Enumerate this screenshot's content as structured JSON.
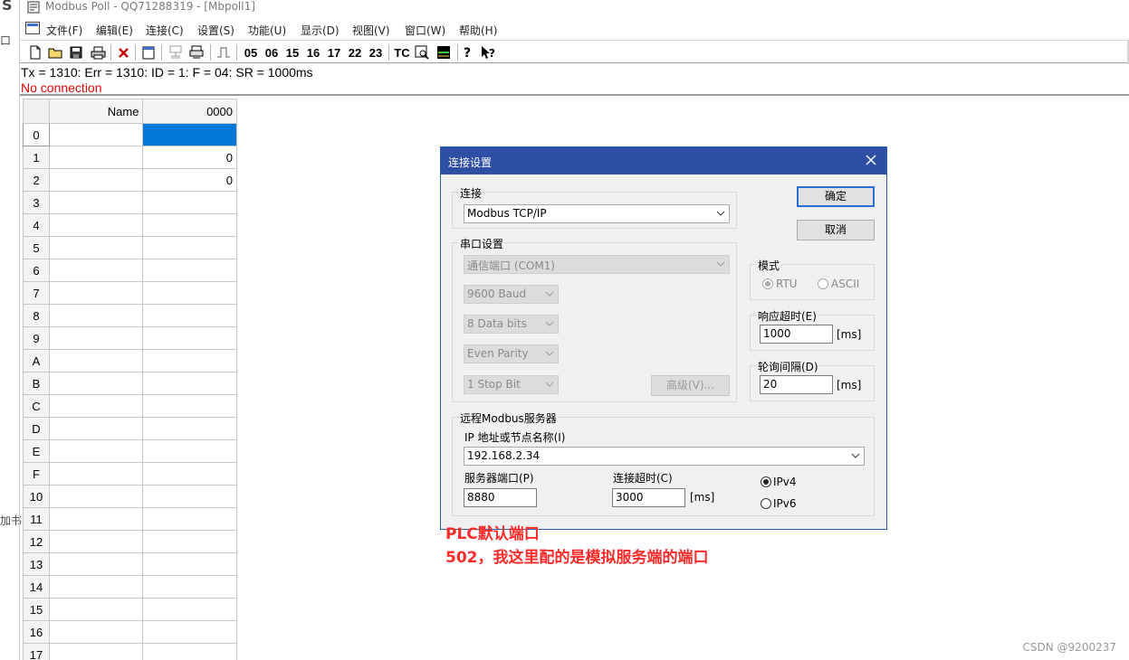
{
  "window": {
    "title": "Modbus Poll - QQ71288319 - [Mbpoll1]"
  },
  "background_fragments": [
    "S",
    "口",
    "加书"
  ],
  "menu": {
    "items": [
      "文件(F)",
      "编辑(E)",
      "连接(C)",
      "设置(S)",
      "功能(U)",
      "显示(D)",
      "视图(V)",
      "窗口(W)",
      "帮助(H)"
    ]
  },
  "toolbar": {
    "function_codes": [
      "05",
      "06",
      "15",
      "16",
      "17",
      "22",
      "23"
    ],
    "tc_label": "TC"
  },
  "status": {
    "line1": "Tx = 1310: Err = 1310: ID = 1: F = 04: SR = 1000ms",
    "line2": "No connection"
  },
  "grid": {
    "col_name": "Name",
    "col_value": "0000",
    "rows": [
      {
        "idx": "0",
        "name": "",
        "value": ""
      },
      {
        "idx": "1",
        "name": "",
        "value": "0"
      },
      {
        "idx": "2",
        "name": "",
        "value": "0"
      },
      {
        "idx": "3",
        "name": "",
        "value": ""
      },
      {
        "idx": "4",
        "name": "",
        "value": ""
      },
      {
        "idx": "5",
        "name": "",
        "value": ""
      },
      {
        "idx": "6",
        "name": "",
        "value": ""
      },
      {
        "idx": "7",
        "name": "",
        "value": ""
      },
      {
        "idx": "8",
        "name": "",
        "value": ""
      },
      {
        "idx": "9",
        "name": "",
        "value": ""
      },
      {
        "idx": "A",
        "name": "",
        "value": ""
      },
      {
        "idx": "B",
        "name": "",
        "value": ""
      },
      {
        "idx": "C",
        "name": "",
        "value": ""
      },
      {
        "idx": "D",
        "name": "",
        "value": ""
      },
      {
        "idx": "E",
        "name": "",
        "value": ""
      },
      {
        "idx": "F",
        "name": "",
        "value": ""
      },
      {
        "idx": "10",
        "name": "",
        "value": ""
      },
      {
        "idx": "11",
        "name": "",
        "value": ""
      },
      {
        "idx": "12",
        "name": "",
        "value": ""
      },
      {
        "idx": "13",
        "name": "",
        "value": ""
      },
      {
        "idx": "14",
        "name": "",
        "value": ""
      },
      {
        "idx": "15",
        "name": "",
        "value": ""
      },
      {
        "idx": "16",
        "name": "",
        "value": ""
      },
      {
        "idx": "17",
        "name": "",
        "value": ""
      }
    ]
  },
  "dialog": {
    "title": "连接设置",
    "ok": "确定",
    "cancel": "取消",
    "connection_group": "连接",
    "connection_value": "Modbus TCP/IP",
    "serial_group": "串口设置",
    "serial_port": "通信端口 (COM1)",
    "baud": "9600 Baud",
    "data_bits": "8 Data bits",
    "parity": "Even Parity",
    "stop_bits": "1 Stop Bit",
    "advanced": "高级(V)...",
    "mode_group": "模式",
    "mode_rtu": "RTU",
    "mode_ascii": "ASCII",
    "response_group": "响应超时(E)",
    "response_value": "1000",
    "response_unit": "[ms]",
    "poll_group": "轮询间隔(D)",
    "poll_value": "20",
    "poll_unit": "[ms]",
    "remote_group": "远程Modbus服务器",
    "ip_label": "IP 地址或节点名称(I)",
    "ip_value": "192.168.2.34",
    "port_label": "服务器端口(P)",
    "port_value": "8880",
    "timeout_label": "连接超时(C)",
    "timeout_value": "3000",
    "timeout_unit": "[ms]",
    "ipv4": "IPv4",
    "ipv6": "IPv6"
  },
  "annotation": {
    "line1": "PLC默认端口",
    "line2": "502，我这里配的是模拟服务端的端口",
    "color": "#ff2a2a"
  },
  "watermark": "CSDN @9200237",
  "colors": {
    "dialog_title_bg": "#2f4fa5",
    "selection": "#0078d7",
    "status_error": "#e00000"
  }
}
